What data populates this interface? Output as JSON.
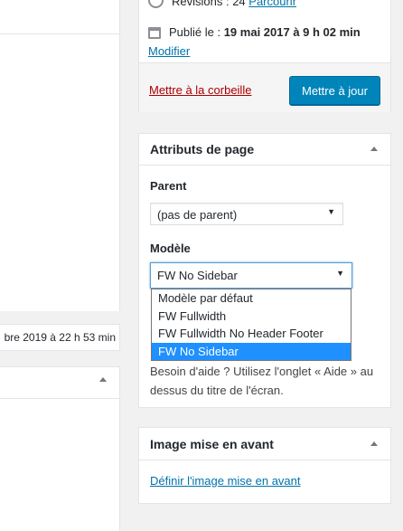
{
  "left_panel": {
    "status_text": "bre 2019 à 22 h 53 min"
  },
  "publish": {
    "revisions_label": "Révisions : 24",
    "revisions_link": "Parcourir",
    "published_prefix": "Publié le : ",
    "published_date": "19 mai 2017 à 9 h 02 min",
    "modify_link": "Modifier",
    "trash_link": "Mettre à la corbeille",
    "update_button": "Mettre à jour"
  },
  "page_attributes": {
    "title": "Attributs de page",
    "parent_label": "Parent",
    "parent_value": "(pas de parent)",
    "model_label": "Modèle",
    "model_value": "FW No Sidebar",
    "model_options": [
      "Modèle par défaut",
      "FW Fullwidth",
      "FW Fullwidth No Header Footer",
      "FW No Sidebar"
    ],
    "help_text": "Besoin d'aide ? Utilisez l'onglet « Aide » au dessus du titre de l'écran."
  },
  "featured_image": {
    "title": "Image mise en avant",
    "link": "Définir l'image mise en avant"
  },
  "colors": {
    "primary_button": "#0085ba",
    "link": "#0073aa",
    "trash": "#aa0000",
    "selected_option": "#1e90ff"
  }
}
